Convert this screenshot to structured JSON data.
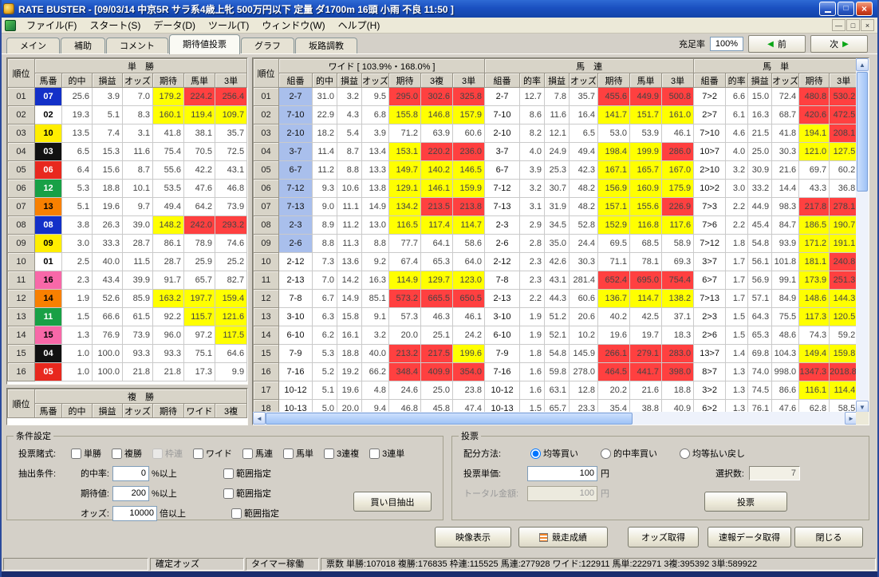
{
  "window": {
    "title": "RATE BUSTER - [09/03/14 中京5R サラ系4歳上牝 500万円以下 定量 ダ1700m 16頭 小雨 不良 11:50 ]"
  },
  "menu": {
    "items": [
      "ファイル(F)",
      "スタート(S)",
      "データ(D)",
      "ツール(T)",
      "ウィンドウ(W)",
      "ヘルプ(H)"
    ]
  },
  "tabs": {
    "items": [
      "メイン",
      "補助",
      "コメント",
      "期待値投票",
      "グラフ",
      "坂路調教"
    ],
    "active": "期待値投票"
  },
  "toolbar": {
    "fill_label": "充足率",
    "fill_value": "100%",
    "prev_label": "前",
    "next_label": "次"
  },
  "win_table": {
    "title": "単　勝",
    "headers": [
      "順位",
      "馬番",
      "的中",
      "損益",
      "オッズ",
      "期待",
      "馬単",
      "3単"
    ],
    "rows": [
      {
        "rank": "01",
        "horse": "07",
        "vals": [
          25.6,
          3.9,
          7.0,
          179.2,
          224.2,
          256.4
        ]
      },
      {
        "rank": "02",
        "horse": "02",
        "vals": [
          19.3,
          5.1,
          8.3,
          160.1,
          119.4,
          109.7
        ]
      },
      {
        "rank": "03",
        "horse": "10",
        "vals": [
          13.5,
          7.4,
          3.1,
          41.8,
          38.1,
          35.7
        ]
      },
      {
        "rank": "04",
        "horse": "03",
        "vals": [
          6.5,
          15.3,
          11.6,
          75.4,
          70.5,
          72.5
        ]
      },
      {
        "rank": "05",
        "horse": "06",
        "vals": [
          6.4,
          15.6,
          8.7,
          55.6,
          42.2,
          43.1
        ]
      },
      {
        "rank": "06",
        "horse": "12",
        "vals": [
          5.3,
          18.8,
          10.1,
          53.5,
          47.6,
          46.8
        ]
      },
      {
        "rank": "07",
        "horse": "13",
        "vals": [
          5.1,
          19.6,
          9.7,
          49.4,
          64.2,
          73.9
        ]
      },
      {
        "rank": "08",
        "horse": "08",
        "vals": [
          3.8,
          26.3,
          39.0,
          148.2,
          242.0,
          293.2
        ]
      },
      {
        "rank": "09",
        "horse": "09",
        "vals": [
          3.0,
          33.3,
          28.7,
          86.1,
          78.9,
          74.6
        ]
      },
      {
        "rank": "10",
        "horse": "01",
        "vals": [
          2.5,
          40.0,
          11.5,
          28.7,
          25.9,
          25.2
        ]
      },
      {
        "rank": "11",
        "horse": "16",
        "vals": [
          2.3,
          43.4,
          39.9,
          91.7,
          65.7,
          82.7
        ]
      },
      {
        "rank": "12",
        "horse": "14",
        "vals": [
          1.9,
          52.6,
          85.9,
          163.2,
          197.7,
          159.4
        ]
      },
      {
        "rank": "13",
        "horse": "11",
        "vals": [
          1.5,
          66.6,
          61.5,
          92.2,
          115.7,
          121.6
        ]
      },
      {
        "rank": "14",
        "horse": "15",
        "vals": [
          1.3,
          76.9,
          73.9,
          96.0,
          97.2,
          117.5
        ]
      },
      {
        "rank": "15",
        "horse": "04",
        "vals": [
          1.0,
          100.0,
          93.3,
          93.3,
          75.1,
          64.6
        ]
      },
      {
        "rank": "16",
        "horse": "05",
        "vals": [
          1.0,
          100.0,
          21.8,
          21.8,
          17.3,
          9.9
        ]
      }
    ]
  },
  "fuku_table": {
    "title": "複　勝",
    "headers": [
      "順位",
      "馬番",
      "的中",
      "損益",
      "オッズ",
      "期待",
      "ワイド",
      "3複"
    ]
  },
  "right": {
    "rank_header": "順位",
    "ranks": [
      "01",
      "02",
      "03",
      "04",
      "05",
      "06",
      "07",
      "08",
      "09",
      "10",
      "11",
      "12",
      "13",
      "14",
      "15",
      "16",
      "17",
      "18"
    ],
    "wide": {
      "title": "ワイド [ 103.9%・168.0% ]",
      "headers": [
        "組番",
        "的中",
        "損益",
        "オッズ",
        "期待",
        "3複",
        "3単"
      ],
      "rows": [
        {
          "combo": "2-7",
          "sel": true,
          "vals": [
            31.0,
            3.2,
            9.5,
            295.0,
            302.6,
            325.8
          ]
        },
        {
          "combo": "7-10",
          "sel": true,
          "vals": [
            22.9,
            4.3,
            6.8,
            155.8,
            146.8,
            157.9
          ]
        },
        {
          "combo": "2-10",
          "sel": true,
          "vals": [
            18.2,
            5.4,
            3.9,
            71.2,
            63.9,
            60.6
          ]
        },
        {
          "combo": "3-7",
          "sel": true,
          "vals": [
            11.4,
            8.7,
            13.4,
            153.1,
            220.2,
            236.0
          ]
        },
        {
          "combo": "6-7",
          "sel": true,
          "vals": [
            11.2,
            8.8,
            13.3,
            149.7,
            140.2,
            146.5
          ]
        },
        {
          "combo": "7-12",
          "sel": true,
          "vals": [
            9.3,
            10.6,
            13.8,
            129.1,
            146.1,
            159.9
          ]
        },
        {
          "combo": "7-13",
          "sel": true,
          "vals": [
            9.0,
            11.1,
            14.9,
            134.2,
            213.5,
            213.8
          ]
        },
        {
          "combo": "2-3",
          "sel": true,
          "vals": [
            8.9,
            11.2,
            13.0,
            116.5,
            117.4,
            114.7
          ]
        },
        {
          "combo": "2-6",
          "sel": true,
          "vals": [
            8.8,
            11.3,
            8.8,
            77.7,
            64.1,
            58.6
          ]
        },
        {
          "combo": "2-12",
          "sel": false,
          "vals": [
            7.3,
            13.6,
            9.2,
            67.4,
            65.3,
            64.0
          ]
        },
        {
          "combo": "2-13",
          "sel": false,
          "vals": [
            7.0,
            14.2,
            16.3,
            114.9,
            129.7,
            123.0
          ]
        },
        {
          "combo": "7-8",
          "sel": false,
          "vals": [
            6.7,
            14.9,
            85.1,
            573.2,
            665.5,
            650.5
          ]
        },
        {
          "combo": "3-10",
          "sel": false,
          "vals": [
            6.3,
            15.8,
            9.1,
            57.3,
            46.3,
            46.1
          ]
        },
        {
          "combo": "6-10",
          "sel": false,
          "vals": [
            6.2,
            16.1,
            3.2,
            20.0,
            25.1,
            24.2
          ]
        },
        {
          "combo": "7-9",
          "sel": false,
          "vals": [
            5.3,
            18.8,
            40.0,
            213.2,
            217.5,
            199.6
          ]
        },
        {
          "combo": "7-16",
          "sel": false,
          "vals": [
            5.2,
            19.2,
            66.2,
            348.4,
            409.9,
            354.0
          ]
        },
        {
          "combo": "10-12",
          "sel": false,
          "vals": [
            5.1,
            19.6,
            4.8,
            24.6,
            25.0,
            23.8
          ]
        },
        {
          "combo": "10-13",
          "sel": false,
          "vals": [
            5.0,
            20.0,
            9.4,
            46.8,
            45.8,
            47.4
          ]
        }
      ]
    },
    "umaren": {
      "title": "馬　連",
      "headers": [
        "組番",
        "的率",
        "損益",
        "オッズ",
        "期待",
        "馬単",
        "3単"
      ],
      "rows": [
        {
          "combo": "2-7",
          "vals": [
            12.7,
            7.8,
            35.7,
            455.6,
            449.9,
            500.8
          ]
        },
        {
          "combo": "7-10",
          "vals": [
            8.6,
            11.6,
            16.4,
            141.7,
            151.7,
            161.0
          ]
        },
        {
          "combo": "2-10",
          "vals": [
            8.2,
            12.1,
            6.5,
            53.0,
            53.9,
            46.1
          ]
        },
        {
          "combo": "3-7",
          "vals": [
            4.0,
            24.9,
            49.4,
            198.4,
            199.9,
            286.0
          ]
        },
        {
          "combo": "6-7",
          "vals": [
            3.9,
            25.3,
            42.3,
            167.1,
            165.7,
            167.0
          ]
        },
        {
          "combo": "7-12",
          "vals": [
            3.2,
            30.7,
            48.2,
            156.9,
            160.9,
            175.9
          ]
        },
        {
          "combo": "7-13",
          "vals": [
            3.1,
            31.9,
            48.2,
            157.1,
            155.6,
            226.9
          ]
        },
        {
          "combo": "2-3",
          "vals": [
            2.9,
            34.5,
            52.8,
            152.9,
            116.8,
            117.6
          ]
        },
        {
          "combo": "2-6",
          "vals": [
            2.8,
            35.0,
            24.4,
            69.5,
            68.5,
            58.9
          ]
        },
        {
          "combo": "2-12",
          "vals": [
            2.3,
            42.6,
            30.3,
            71.1,
            78.1,
            69.3
          ]
        },
        {
          "combo": "7-8",
          "vals": [
            2.3,
            43.1,
            281.4,
            652.4,
            695.0,
            754.4
          ]
        },
        {
          "combo": "2-13",
          "vals": [
            2.2,
            44.3,
            60.6,
            136.7,
            114.7,
            138.2
          ]
        },
        {
          "combo": "3-10",
          "vals": [
            1.9,
            51.2,
            20.6,
            40.2,
            42.5,
            37.1
          ]
        },
        {
          "combo": "6-10",
          "vals": [
            1.9,
            52.1,
            10.2,
            19.6,
            19.7,
            18.3
          ]
        },
        {
          "combo": "7-9",
          "vals": [
            1.8,
            54.8,
            145.9,
            266.1,
            279.1,
            283.0
          ]
        },
        {
          "combo": "7-16",
          "vals": [
            1.6,
            59.8,
            278.0,
            464.5,
            441.7,
            398.0
          ]
        },
        {
          "combo": "10-12",
          "vals": [
            1.6,
            63.1,
            12.8,
            20.2,
            21.6,
            18.8
          ]
        },
        {
          "combo": "10-13",
          "vals": [
            1.5,
            65.7,
            23.3,
            35.4,
            38.8,
            40.9
          ]
        }
      ]
    },
    "umatan": {
      "title": "馬　単",
      "headers": [
        "組番",
        "的率",
        "損益",
        "オッズ",
        "期待",
        "3単"
      ],
      "rows": [
        {
          "combo": "7>2",
          "vals": [
            6.6,
            15.0,
            72.4,
            480.8,
            530.2
          ]
        },
        {
          "combo": "2>7",
          "vals": [
            6.1,
            16.3,
            68.7,
            420.6,
            472.5
          ]
        },
        {
          "combo": "7>10",
          "vals": [
            4.6,
            21.5,
            41.8,
            194.1,
            208.1
          ]
        },
        {
          "combo": "10>7",
          "vals": [
            4.0,
            25.0,
            30.3,
            121.0,
            127.5
          ]
        },
        {
          "combo": "2>10",
          "vals": [
            3.2,
            30.9,
            21.6,
            69.7,
            60.2
          ]
        },
        {
          "combo": "10>2",
          "vals": [
            3.0,
            33.2,
            14.4,
            43.3,
            36.8
          ]
        },
        {
          "combo": "7>3",
          "vals": [
            2.2,
            44.9,
            98.3,
            217.8,
            278.1
          ]
        },
        {
          "combo": "7>6",
          "vals": [
            2.2,
            45.4,
            84.7,
            186.5,
            190.7
          ]
        },
        {
          "combo": "7>12",
          "vals": [
            1.8,
            54.8,
            93.9,
            171.2,
            191.1
          ]
        },
        {
          "combo": "3>7",
          "vals": [
            1.7,
            56.1,
            101.8,
            181.1,
            240.8
          ]
        },
        {
          "combo": "6>7",
          "vals": [
            1.7,
            56.9,
            99.1,
            173.9,
            251.3
          ]
        },
        {
          "combo": "7>13",
          "vals": [
            1.7,
            57.1,
            84.9,
            148.6,
            144.3
          ]
        },
        {
          "combo": "2>3",
          "vals": [
            1.5,
            64.3,
            75.5,
            117.3,
            120.5
          ]
        },
        {
          "combo": "2>6",
          "vals": [
            1.5,
            65.3,
            48.6,
            74.3,
            59.2
          ]
        },
        {
          "combo": "13>7",
          "vals": [
            1.4,
            69.8,
            104.3,
            149.4,
            159.8
          ]
        },
        {
          "combo": "8>7",
          "vals": [
            1.3,
            74.0,
            998.0,
            1347.3,
            2018.8
          ]
        },
        {
          "combo": "3>2",
          "vals": [
            1.3,
            74.5,
            86.6,
            116.1,
            114.4
          ]
        },
        {
          "combo": "6>2",
          "vals": [
            1.3,
            76.1,
            47.6,
            62.8,
            58.5
          ]
        }
      ]
    }
  },
  "conditions": {
    "legend": "条件設定",
    "bet_type_label": "投票賭式:",
    "bet_types": [
      {
        "id": "tansho",
        "label": "単勝",
        "enabled": true
      },
      {
        "id": "fukusho",
        "label": "複勝",
        "enabled": true
      },
      {
        "id": "wakuren",
        "label": "枠連",
        "enabled": false
      },
      {
        "id": "wide",
        "label": "ワイド",
        "enabled": true
      },
      {
        "id": "umaren",
        "label": "馬連",
        "enabled": true
      },
      {
        "id": "umatan",
        "label": "馬単",
        "enabled": true
      },
      {
        "id": "sanrenpuku",
        "label": "3連複",
        "enabled": true
      },
      {
        "id": "sanrentan",
        "label": "3連単",
        "enabled": true
      }
    ],
    "extract_label": "抽出条件:",
    "criteria": [
      {
        "id": "hitrate",
        "label": "的中率:",
        "value": "0",
        "unit": "%以上",
        "range_label": "範囲指定"
      },
      {
        "id": "expected",
        "label": "期待値:",
        "value": "200",
        "unit": "%以上",
        "range_label": "範囲指定"
      },
      {
        "id": "odds",
        "label": "オッズ:",
        "value": "10000",
        "unit": "倍以上",
        "range_label": "範囲指定"
      }
    ],
    "extract_button": "買い目抽出"
  },
  "vote": {
    "legend": "投票",
    "alloc_label": "配分方法:",
    "alloc_options": [
      {
        "id": "equal",
        "label": "均等買い",
        "selected": true
      },
      {
        "id": "hitrate",
        "label": "的中率買い",
        "selected": false
      },
      {
        "id": "equal-payout",
        "label": "均等払い戻し",
        "selected": false
      }
    ],
    "unit_label": "投票単価:",
    "unit_value": "100",
    "unit_suffix": "円",
    "selection_label": "選択数:",
    "selection_value": "7",
    "total_label": "トータル金額:",
    "total_value": "100",
    "total_suffix": "円",
    "vote_button": "投票"
  },
  "action_buttons": [
    "映像表示",
    "競走成績",
    "オッズ取得",
    "速報データ取得",
    "閉じる"
  ],
  "status": {
    "mode": "確定オッズ",
    "timer": "タイマー稼働",
    "votes_label": "票数",
    "counts": [
      {
        "label": "単勝",
        "value": "107018"
      },
      {
        "label": "複勝",
        "value": "176835"
      },
      {
        "label": "枠連",
        "value": "115525"
      },
      {
        "label": "馬連",
        "value": "277928"
      },
      {
        "label": "ワイド",
        "value": "122911"
      },
      {
        "label": "馬単",
        "value": "222971"
      },
      {
        "label": "3複",
        "value": "395392"
      },
      {
        "label": "3単",
        "value": "589922"
      }
    ]
  },
  "theme": {
    "yellow": "#ffff00",
    "red": "#ff4040",
    "selected_combo": "#a9bfec",
    "frame_colors": [
      {
        "bg": "#ffffff",
        "fg": "#000000"
      },
      {
        "bg": "#111111",
        "fg": "#ffffff"
      },
      {
        "bg": "#e8281e",
        "fg": "#ffffff"
      },
      {
        "bg": "#1330c8",
        "fg": "#ffffff"
      },
      {
        "bg": "#ffee00",
        "fg": "#000000"
      },
      {
        "bg": "#18a046",
        "fg": "#ffffff"
      },
      {
        "bg": "#f88000",
        "fg": "#000000"
      },
      {
        "bg": "#f868a8",
        "fg": "#000000"
      }
    ]
  }
}
